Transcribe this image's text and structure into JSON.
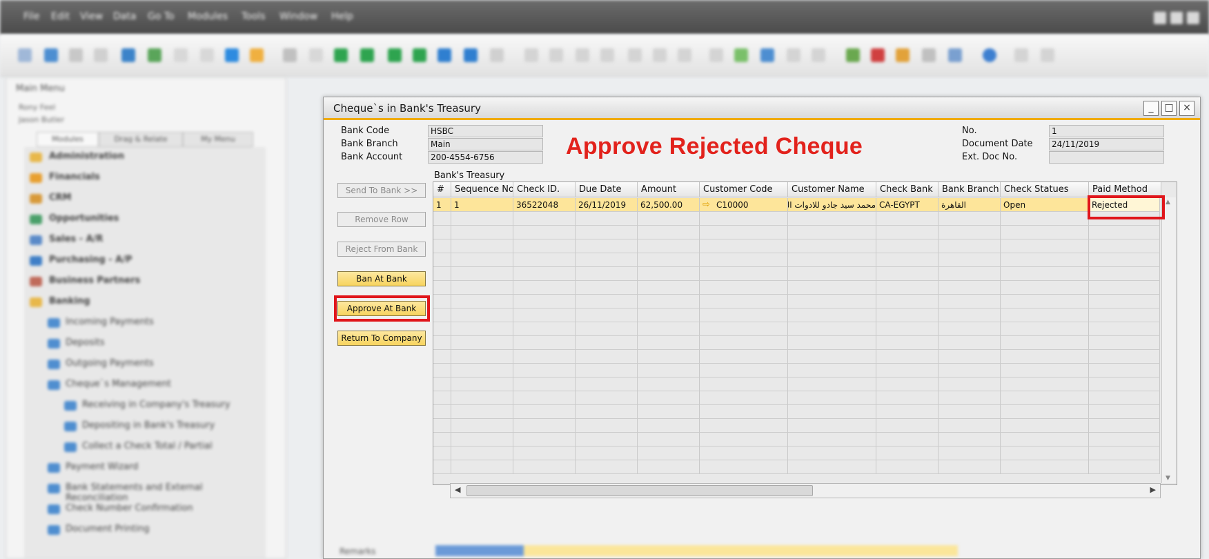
{
  "menubar": {
    "items": [
      "File",
      "Edit",
      "View",
      "Data",
      "Go To",
      "Modules",
      "Tools",
      "Window",
      "Help"
    ]
  },
  "main_menu": {
    "title": "Main Menu",
    "users": [
      "Rony Feel",
      "Jason Butler"
    ],
    "tabs": [
      "Modules",
      "Drag & Relate",
      "My Menu"
    ],
    "items": [
      {
        "label": "Administration",
        "bold": true
      },
      {
        "label": "Financials",
        "bold": true
      },
      {
        "label": "CRM",
        "bold": true
      },
      {
        "label": "Opportunities",
        "bold": true
      },
      {
        "label": "Sales - A/R",
        "bold": true
      },
      {
        "label": "Purchasing - A/P",
        "bold": true
      },
      {
        "label": "Business Partners",
        "bold": true
      },
      {
        "label": "Banking",
        "bold": true
      },
      {
        "label": "Incoming Payments",
        "bold": false
      },
      {
        "label": "Deposits",
        "bold": false
      },
      {
        "label": "Outgoing Payments",
        "bold": false
      },
      {
        "label": "Cheque`s Management",
        "bold": false
      },
      {
        "label": "Receiving in Company's Treasury",
        "bold": false
      },
      {
        "label": "Depositing in Bank's Treasury",
        "bold": false
      },
      {
        "label": "Collect a Check Total / Partial",
        "bold": false
      },
      {
        "label": "Payment Wizard",
        "bold": false
      },
      {
        "label": "Bank Statements and External Reconciliation",
        "bold": false
      },
      {
        "label": "Check Number Confirmation",
        "bold": false
      },
      {
        "label": "Document Printing",
        "bold": false
      }
    ]
  },
  "dialog": {
    "title": "Cheque`s in Bank's Treasury",
    "controls": {
      "minimize": "_",
      "maximize": "□",
      "close": "×"
    },
    "header_left": [
      {
        "label": "Bank Code",
        "value": "HSBC"
      },
      {
        "label": "Bank Branch",
        "value": "Main"
      },
      {
        "label": "Bank Account",
        "value": "200-4554-6756"
      }
    ],
    "header_right": [
      {
        "label": "No.",
        "value": "1"
      },
      {
        "label": "Document Date",
        "value": "24/11/2019"
      },
      {
        "label": "Ext. Doc No.",
        "value": ""
      }
    ],
    "headline": "Approve Rejected Cheque",
    "buttons": [
      {
        "label": "Send To Bank >>",
        "enabled": false
      },
      {
        "label": "Remove Row",
        "enabled": false
      },
      {
        "label": "Reject From Bank",
        "enabled": false
      },
      {
        "label": "Ban At Bank",
        "enabled": true
      },
      {
        "label": "Approve At Bank",
        "enabled": true,
        "highlighted": true
      },
      {
        "label": "Return To Company",
        "enabled": true
      }
    ],
    "grid": {
      "caption": "Bank's Treasury",
      "columns": [
        "#",
        "Sequence No.",
        "Check ID.",
        "Due Date",
        "Amount",
        "Customer Code",
        "Customer Name",
        "Check Bank",
        "Bank Branch",
        "Check Statues",
        "Paid Method"
      ],
      "rows": [
        [
          "1",
          "1",
          "36522048",
          "26/11/2019",
          "62,500.00",
          "C10000",
          "محمد سيد جادو للادوات الصحية",
          "CA-EGYPT",
          "القاهرة",
          "Open",
          "Rejected"
        ]
      ],
      "highlighted_cell": "Rejected"
    },
    "remarks_label": "Remarks"
  },
  "colors": {
    "accent": "#f0ab00",
    "highlight_border": "#e0161b",
    "headline": "#e2221c",
    "selected_row": "#fde59a"
  }
}
